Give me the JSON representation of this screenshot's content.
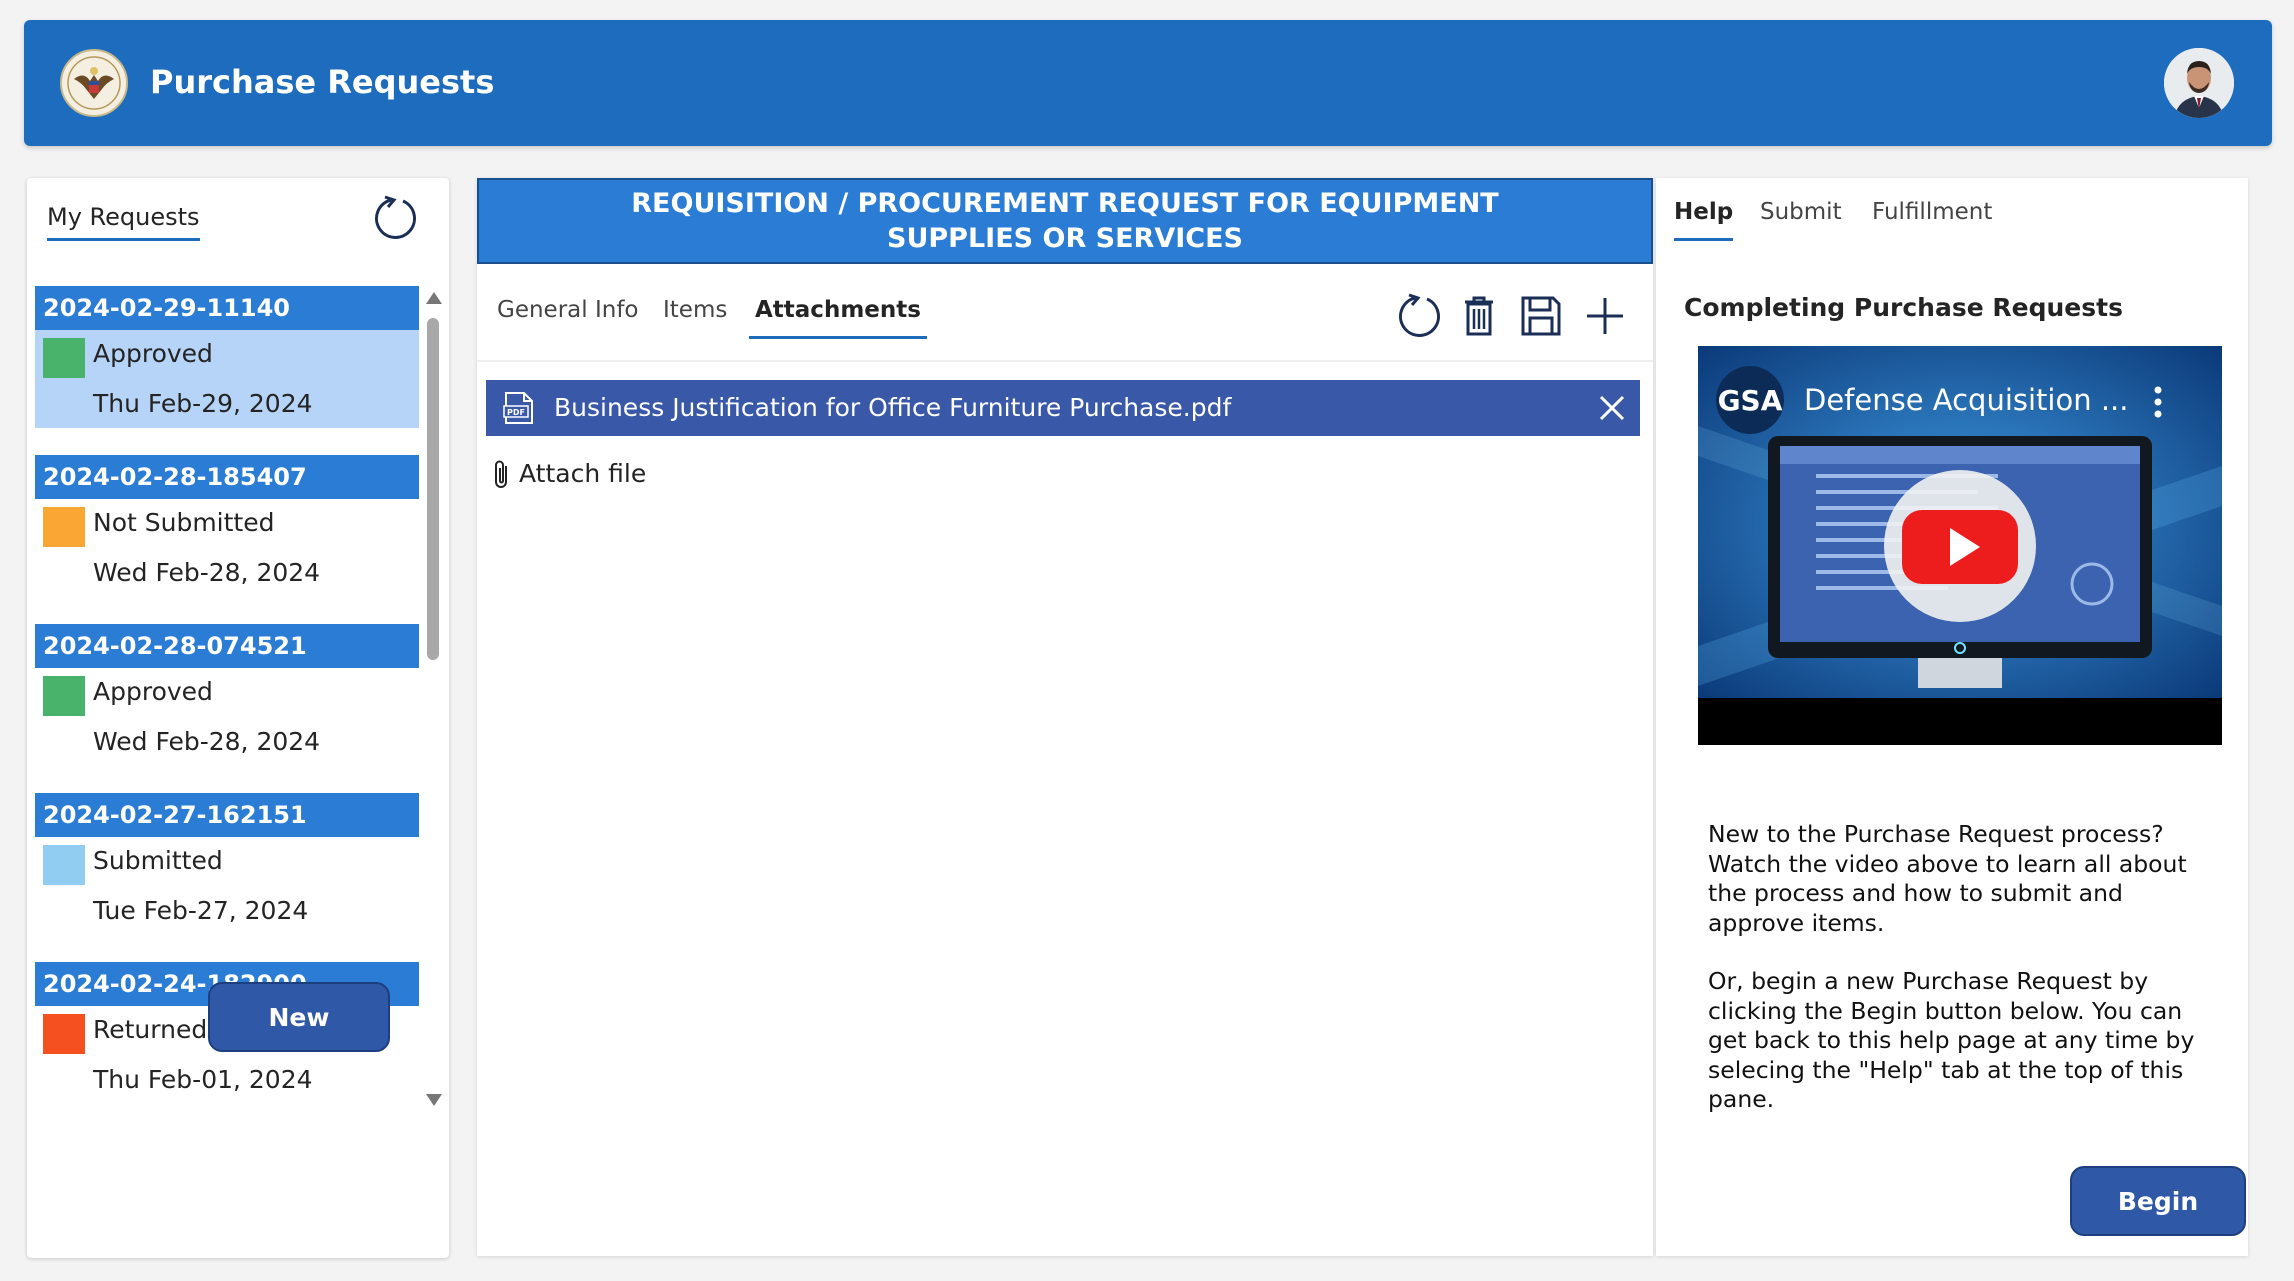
{
  "header": {
    "title": "Purchase Requests"
  },
  "requests_panel": {
    "tab_label": "My Requests",
    "new_label": "New",
    "items": [
      {
        "id": "2024-02-29-11140",
        "status": "Approved",
        "date": "Thu Feb-29, 2024",
        "color": "#49b36b",
        "selected": true
      },
      {
        "id": "2024-02-28-185407",
        "status": "Not Submitted",
        "date": "Wed Feb-28, 2024",
        "color": "#f9a635",
        "selected": false
      },
      {
        "id": "2024-02-28-074521",
        "status": "Approved",
        "date": "Wed Feb-28, 2024",
        "color": "#49b36b",
        "selected": false
      },
      {
        "id": "2024-02-27-162151",
        "status": "Submitted",
        "date": "Tue Feb-27, 2024",
        "color": "#90cdf0",
        "selected": false
      },
      {
        "id": "2024-02-24-182900",
        "status": "Returned",
        "date": "Thu Feb-01, 2024",
        "color": "#f5501f",
        "selected": false
      }
    ]
  },
  "form": {
    "title_line1": "REQUISITION / PROCUREMENT REQUEST FOR EQUIPMENT",
    "title_line2": "SUPPLIES OR SERVICES",
    "tabs": [
      {
        "label": "General Info",
        "active": false
      },
      {
        "label": "Items",
        "active": false
      },
      {
        "label": "Attachments",
        "active": true
      }
    ],
    "toolbar": [
      "refresh-icon",
      "trash-icon",
      "save-icon",
      "add-icon"
    ],
    "attachments": [
      {
        "name": "Business Justification for Office Furniture Purchase.pdf"
      }
    ],
    "attach_label": "Attach file"
  },
  "help_panel": {
    "tabs": [
      {
        "label": "Help",
        "active": true
      },
      {
        "label": "Submit",
        "active": false
      },
      {
        "label": "Fulfillment",
        "active": false
      }
    ],
    "heading": "Completing Purchase Requests",
    "video": {
      "channel": "GSA",
      "title": "Defense Acquisition ..."
    },
    "paragraph1": "New to the Purchase Request process? Watch the video above to learn all about the process and how to submit and approve items.",
    "paragraph2": "Or, begin a new Purchase Request by clicking the Begin button below. You can get back to this help page at any time by selecing the \"Help\" tab at the top of this pane.",
    "begin_label": "Begin"
  },
  "colors": {
    "header_blue": "#1e6cbd",
    "item_header_blue": "#2b7cd4",
    "selected_row": "#b6d4f7",
    "button_blue": "#2f58a6",
    "attachment_bar": "#3a58a8"
  }
}
